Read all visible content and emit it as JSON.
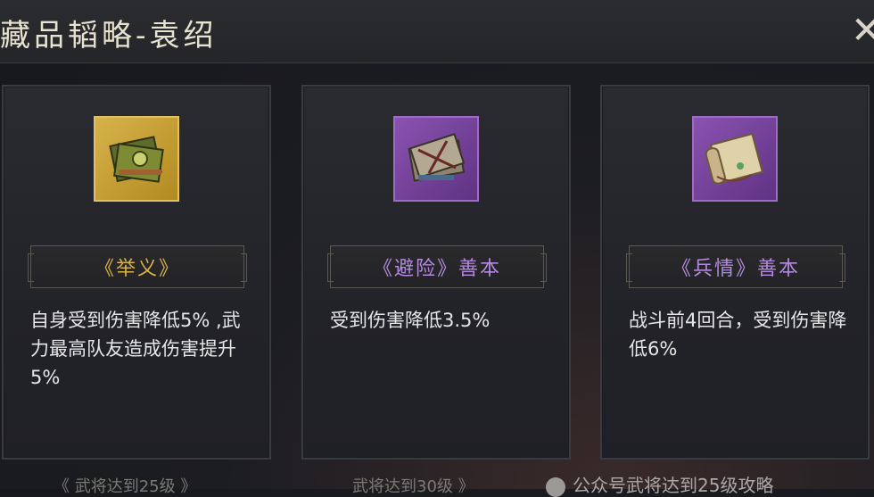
{
  "header": {
    "title": "藏品韬略-袁绍",
    "close_icon": "close-icon"
  },
  "cards": [
    {
      "icon": "green-book-bundle-icon",
      "frame": "gold",
      "name": "《举义》",
      "desc": "自身受到伤害降低5% ,武力最高队友造成伤害提升5%"
    },
    {
      "icon": "tied-book-bundle-icon",
      "frame": "purple",
      "name": "《避险》善本",
      "desc": "受到伤害降低3.5%"
    },
    {
      "icon": "scroll-icon",
      "frame": "purple",
      "name": "《兵情》善本",
      "desc": "战斗前4回合，受到伤害降低6%"
    }
  ],
  "footer": {
    "req1": "《 武将达到25级 》",
    "req2": "武将达到30级 》"
  },
  "watermark": "公众号武将达到25级攻略"
}
